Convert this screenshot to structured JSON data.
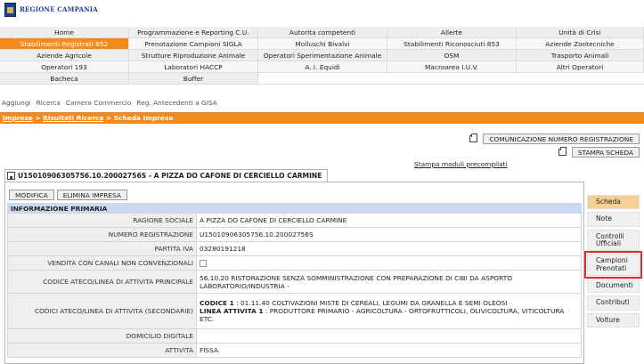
{
  "header": {
    "logo_text": "REGIONE CAMPANIA"
  },
  "menu": {
    "rows": [
      [
        "Home",
        "Programmazione e Reporting C.U.",
        "Autorita competenti",
        "Allerte",
        "Unità di Crisi"
      ],
      [
        "Stabilimenti Registrati 852",
        "Prenotazione Campioni SIGLA",
        "Molluschi Bivalvi",
        "Stabilimenti Riconosciuti 853",
        "Aziende Zootecniche"
      ],
      [
        "Aziende Agricole",
        "Strutture Riproduzione Animale",
        "Operatori Sperimentazione Animale",
        "OSM",
        "Trasporto Animali"
      ],
      [
        "Operatori 193",
        "Laboratori HACCP",
        "A. I. Equidi",
        "Macroarea I.U.V.",
        "Altri Operatori"
      ],
      [
        "Bacheca",
        "Buffer",
        "",
        "",
        ""
      ]
    ],
    "active": "Stabilimenti Registrati 852"
  },
  "subnav": {
    "items": [
      "Aggiungi",
      "Ricerca",
      "Camera Commercio",
      "Reg. Antecedenti a GISA"
    ]
  },
  "breadcrumb": {
    "part1": "Imprese",
    "sep1": " > ",
    "part2": "Risultati Ricerca",
    "sep2": " > ",
    "part3": "Scheda Impresa"
  },
  "actions": {
    "comunicazione": "COMUNICAZIONE NUMERO REGISTRAZIONE",
    "stampa_scheda": "STAMPA SCHEDA",
    "stampa_moduli": "Stampa moduli precompilati"
  },
  "company": {
    "title": "U15010906305756.10.20002756S - A PIZZA DO CAFONE DI CERCIELLO CARMINE"
  },
  "panel": {
    "modifica": "MODIFICA",
    "elimina": "ELIMINA IMPRESA",
    "section_header": "INFORMAZIONE PRIMARIA",
    "rows": [
      {
        "label": "RAGIONE SOCIALE",
        "value": "A PIZZA DO CAFONE DI CERCIELLO CARMINE"
      },
      {
        "label": "NUMERO REGISTRAZIONE",
        "value": "U15010906305756.10.20002756S"
      },
      {
        "label": "PARTITA IVA",
        "value": "03280191218"
      },
      {
        "label": "VENDITA CON CANALI NON CONVENZIONALI",
        "value": ""
      },
      {
        "label": "CODICE ATECO/LINEA DI ATTIVITA PRINCIPALE",
        "value": "56.10.20 RISTORAZIONE SENZA SOMMINISTRAZIONE CON PREPARAZIONE DI CIBI DA ASPORTO LABORATORIO/INDUSTRIA -"
      },
      {
        "label": "CODICI ATECO/LINEA DI ATTIVITA (SECONDARIE)",
        "codice_label": "CODICE 1",
        "codice_value": " : 01.11.40 COLTIVAZIONI MISTE DI CEREALI, LEGUMI DA GRANELLA E SEMI OLEOSI",
        "linea_label": "LINEA ATTIVITA 1",
        "linea_value": " : PRODUTTORE PRIMARIO - AGRICOLTURA - ORTOFRUTTICOLI, OLIVICOLTURA, VITICOLTURA ETC."
      },
      {
        "label": "DOMICILIO DIGITALE",
        "value": ""
      },
      {
        "label": "ATTIVITA",
        "value": "FISSA"
      }
    ]
  },
  "sidetabs": [
    "Scheda",
    "Note",
    "Controlli Ufficiali",
    "Campioni Prenotati",
    "Documenti",
    "Contributi",
    "Volture"
  ],
  "colors": {
    "accent": "#f48b1f",
    "section_header": "#c9d9f3",
    "active_tab": "#f8cf94",
    "highlight": "#e32b2b"
  }
}
